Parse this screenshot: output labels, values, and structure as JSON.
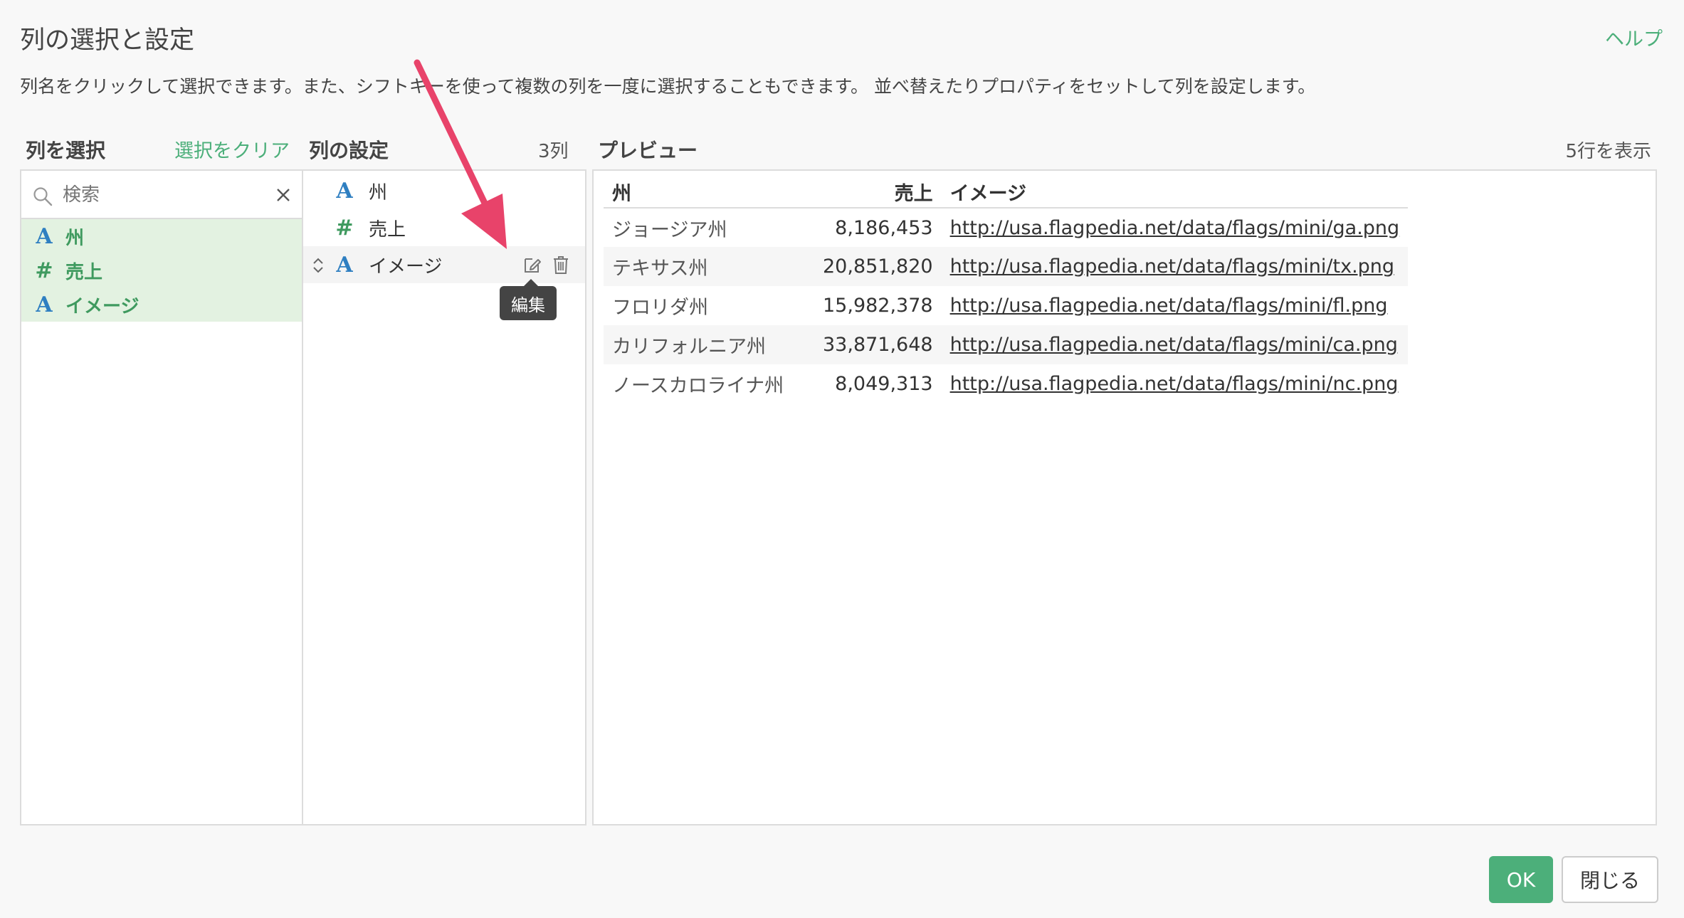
{
  "dialog": {
    "title": "列の選択と設定",
    "help": "ヘルプ",
    "description": "列名をクリックして選択できます。また、シフトキーを使って複数の列を一度に選択することもできます。 並べ替えたりプロパティをセットして列を設定します。"
  },
  "select_section": {
    "title": "列を選択",
    "clear": "選択をクリア",
    "search_placeholder": "検索",
    "items": [
      {
        "type": "A",
        "label": "州"
      },
      {
        "type": "#",
        "label": "売上"
      },
      {
        "type": "A",
        "label": "イメージ"
      }
    ]
  },
  "settings_section": {
    "title": "列の設定",
    "count": "3列",
    "items": [
      {
        "type": "A",
        "label": "州"
      },
      {
        "type": "#",
        "label": "売上"
      },
      {
        "type": "A",
        "label": "イメージ"
      }
    ],
    "tooltip": "編集"
  },
  "preview_section": {
    "title": "プレビュー",
    "rows_info": "5行を表示",
    "columns": [
      "州",
      "売上",
      "イメージ"
    ],
    "rows": [
      [
        "ジョージア州",
        "8,186,453",
        "http://usa.flagpedia.net/data/flags/mini/ga.png"
      ],
      [
        "テキサス州",
        "20,851,820",
        "http://usa.flagpedia.net/data/flags/mini/tx.png"
      ],
      [
        "フロリダ州",
        "15,982,378",
        "http://usa.flagpedia.net/data/flags/mini/fl.png"
      ],
      [
        "カリフォルニア州",
        "33,871,648",
        "http://usa.flagpedia.net/data/flags/mini/ca.png"
      ],
      [
        "ノースカロライナ州",
        "8,049,313",
        "http://usa.flagpedia.net/data/flags/mini/nc.png"
      ]
    ]
  },
  "buttons": {
    "ok": "OK",
    "close": "閉じる"
  },
  "colors": {
    "accent": "#4caf7a",
    "string_type": "#2f7fc1",
    "selected_bg": "#e3f2e1",
    "annotation_arrow": "#e8436a"
  }
}
